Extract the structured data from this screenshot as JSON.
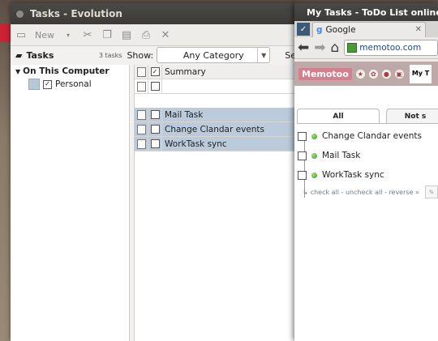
{
  "evolution": {
    "title": "Tasks - Evolution",
    "toolbar": {
      "new_label": "New"
    },
    "sidebar": {
      "title": "Tasks",
      "count": "3 tasks",
      "group": "On This Computer",
      "items": [
        {
          "label": "Personal",
          "checked": true
        }
      ]
    },
    "filter": {
      "show_label": "Show:",
      "category": "Any Category",
      "search_label": "Se"
    },
    "list": {
      "column_summary": "Summary",
      "rows": [
        {
          "summary": "Mail Task"
        },
        {
          "summary": "Change Clandar events"
        },
        {
          "summary": "WorkTask sync"
        }
      ]
    }
  },
  "browser": {
    "title": "My Tasks - ToDo List online -",
    "tab": {
      "label": "Google"
    },
    "url": "memotoo.com",
    "page": {
      "logo": "Memotoo",
      "section_tab": "My T",
      "tabs": [
        {
          "label": "All"
        },
        {
          "label": "Not s"
        }
      ],
      "todos": [
        {
          "label": "Change Clandar events"
        },
        {
          "label": "Mail Task"
        },
        {
          "label": "WorkTask sync"
        }
      ],
      "actions": "check all - uncheck all - reverse »"
    }
  }
}
